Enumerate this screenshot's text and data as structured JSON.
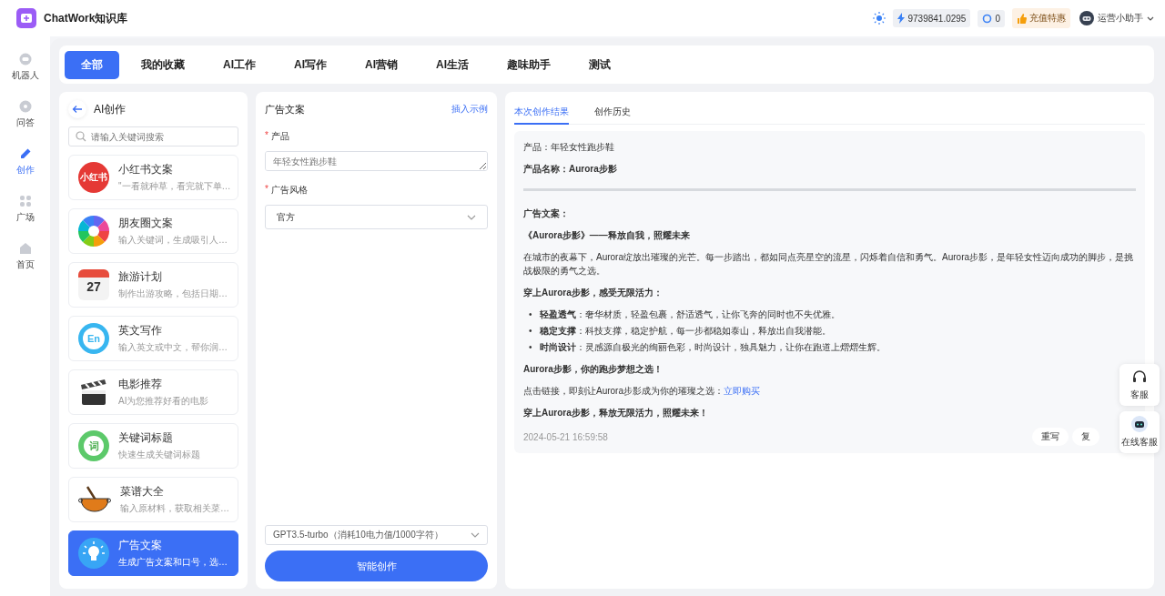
{
  "header": {
    "title": "ChatWork知识库",
    "balance": "9739841.0295",
    "count": "0",
    "promo": "充值特惠",
    "user": "运营小助手"
  },
  "nav": [
    {
      "label": "机器人",
      "kind": "robot",
      "selected": false
    },
    {
      "label": "问答",
      "kind": "chat",
      "selected": false
    },
    {
      "label": "创作",
      "kind": "pen",
      "selected": true
    },
    {
      "label": "广场",
      "kind": "grid",
      "selected": false
    },
    {
      "label": "首页",
      "kind": "home",
      "selected": false
    }
  ],
  "tabs": [
    {
      "label": "全部",
      "selected": true
    },
    {
      "label": "我的收藏",
      "selected": false
    },
    {
      "label": "AI工作",
      "selected": false
    },
    {
      "label": "AI写作",
      "selected": false
    },
    {
      "label": "AI营销",
      "selected": false
    },
    {
      "label": "AI生活",
      "selected": false
    },
    {
      "label": "趣味助手",
      "selected": false
    },
    {
      "label": "测试",
      "selected": false
    }
  ],
  "apps": {
    "title": "AI创作",
    "search_placeholder": "请输入关键词搜索",
    "items": [
      {
        "name": "小红书文案",
        "desc": "\"一看就种草，看完就下单…",
        "kind": "badge",
        "icon_text": "小红书",
        "selected": false
      },
      {
        "name": "朋友圈文案",
        "desc": "输入关键词，生成吸引人…",
        "kind": "aperture",
        "selected": false
      },
      {
        "name": "旅游计划",
        "desc": "制作出游攻略，包括日期…",
        "kind": "calendar",
        "icon_text": "27",
        "selected": false
      },
      {
        "name": "英文写作",
        "desc": "输入英文或中文，帮你润…",
        "kind": "ring",
        "icon_text": "En",
        "selected": false
      },
      {
        "name": "电影推荐",
        "desc": "AI为您推荐好看的电影",
        "kind": "clapper",
        "selected": false
      },
      {
        "name": "关键词标题",
        "desc": "快速生成关键词标题",
        "kind": "word",
        "icon_text": "词",
        "selected": false
      },
      {
        "name": "菜谱大全",
        "desc": "输入原材料，获取相关菜…",
        "kind": "pot",
        "selected": false
      },
      {
        "name": "广告文案",
        "desc": "生成广告文案和口号，选…",
        "kind": "bulb",
        "selected": true
      }
    ]
  },
  "form": {
    "title": "广告文案",
    "insert_link": "插入示例",
    "fields": [
      {
        "label": "产品",
        "kind": "textarea",
        "placeholder": "年轻女性跑步鞋",
        "mark": "*"
      },
      {
        "label": "广告风格",
        "kind": "select",
        "value": "官方",
        "mark": "*"
      }
    ],
    "model": "GPT3.5-turbo（消耗10电力值/1000字符）",
    "submit": "智能创作"
  },
  "result": {
    "tabs": [
      {
        "label": "本次创作结果",
        "selected": true
      },
      {
        "label": "创作历史",
        "selected": false
      }
    ],
    "blocks": [
      {
        "kind": "text",
        "text": "产品：年轻女性跑步鞋"
      },
      {
        "kind": "bold",
        "text": "产品名称：Aurora步影"
      },
      {
        "kind": "rule"
      },
      {
        "kind": "bold",
        "text": "广告文案："
      },
      {
        "kind": "bold",
        "text": "《Aurora步影》——释放自我，照耀未来"
      },
      {
        "kind": "text",
        "text": "在城市的夜幕下，Aurora绽放出璀璨的光芒。每一步踏出，都如同点亮星空的流星，闪烁着自信和勇气。Aurora步影，是年轻女性迈向成功的脚步，是挑战极限的勇气之选。"
      },
      {
        "kind": "bold",
        "text": "穿上Aurora步影，感受无限活力："
      },
      {
        "kind": "list",
        "marker": "•",
        "items": [
          "**轻盈透气**：奢华材质，轻盈包裹，舒适透气，让你飞奔的同时也不失优雅。",
          "**稳定支撑**：科技支撑，稳定护航，每一步都稳如泰山，释放出自我潜能。",
          "**时尚设计**：灵感源自极光的绚丽色彩，时尚设计，独具魅力，让你在跑道上熠熠生辉。"
        ]
      },
      {
        "kind": "bold",
        "text": "Aurora步影，你的跑步梦想之选！"
      },
      {
        "kind": "link",
        "text": "点击链接，即刻让Aurora步影成为你的璀璨之选：",
        "link": "立即购买"
      },
      {
        "kind": "bold",
        "text": "穿上Aurora步影，释放无限活力，照耀未来！"
      }
    ],
    "time": "2024-05-21 16:59:58",
    "actions": [
      "重写",
      "复"
    ]
  },
  "float": [
    {
      "label": "客服",
      "kind": "headset"
    },
    {
      "label": "在线客服",
      "kind": "bot"
    }
  ]
}
